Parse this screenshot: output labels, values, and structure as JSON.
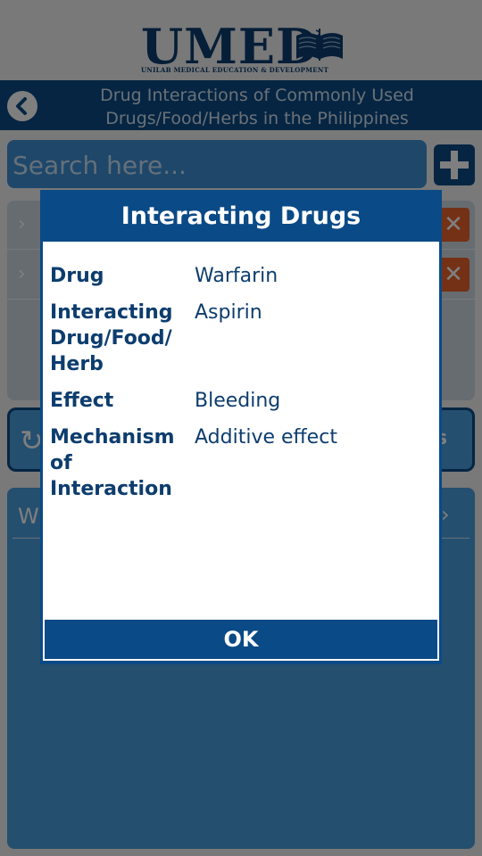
{
  "header": {
    "logo_text": "UMED",
    "logo_subtitle": "UNILAB MEDICAL EDUCATION & DEVELOPMENT",
    "title_line1": "Drug Interactions of Commonly Used",
    "title_line2": "Drugs/Food/Herbs in the Philippines",
    "back_icon": "chevron-left-icon"
  },
  "search": {
    "placeholder": "Search here...",
    "value": "",
    "add_icon": "plus-icon"
  },
  "list": {
    "rows": [
      {
        "chevron": "›",
        "delete": "✕"
      },
      {
        "chevron": "›",
        "delete": "✕"
      }
    ]
  },
  "action_bar": {
    "refresh_icon": "↻",
    "tail_text": "s"
  },
  "bottom_panel": {
    "row_label": "W",
    "chevron": "›"
  },
  "dialog": {
    "title": "Interacting Drugs",
    "fields": [
      {
        "key": "Drug",
        "value": "Warfarin"
      },
      {
        "key": "Interacting Drug/Food/ Herb",
        "value": "Aspirin"
      },
      {
        "key": "Effect",
        "value": "Bleeding"
      },
      {
        "key": "Mechanism of Interaction",
        "value": "Additive effect"
      }
    ],
    "ok_label": "OK"
  },
  "colors": {
    "primary": "#0a4a86",
    "accent": "#3d8ed4",
    "delete": "#e8622a"
  }
}
